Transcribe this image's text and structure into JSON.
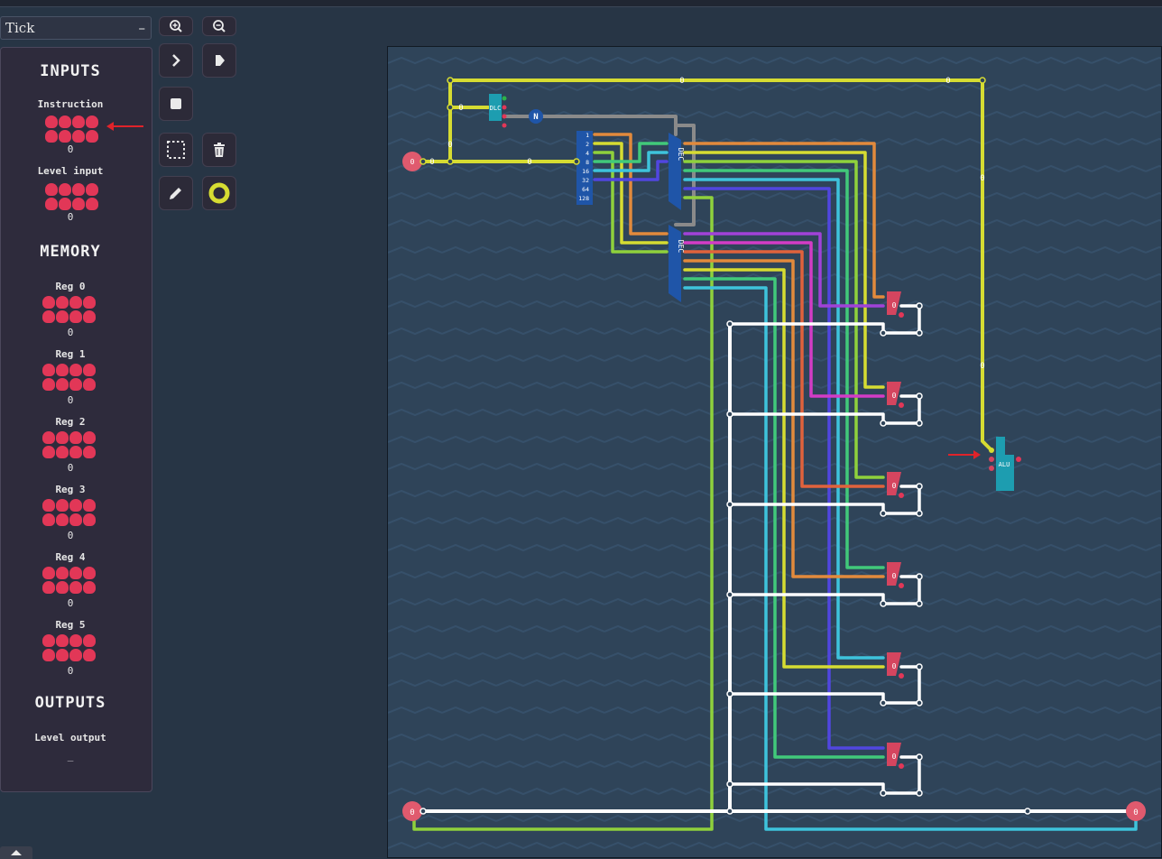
{
  "tick_dropdown": {
    "selected": "Tick",
    "collapse_symbol": "–"
  },
  "panel": {
    "inputs_title": "INPUTS",
    "instruction": {
      "label": "Instruction",
      "value": "0"
    },
    "level_input": {
      "label": "Level input",
      "value": "0"
    },
    "memory_title": "MEMORY",
    "registers": [
      {
        "label": "Reg 0",
        "value": "0"
      },
      {
        "label": "Reg 1",
        "value": "0"
      },
      {
        "label": "Reg 2",
        "value": "0"
      },
      {
        "label": "Reg 3",
        "value": "0"
      },
      {
        "label": "Reg 4",
        "value": "0"
      },
      {
        "label": "Reg 5",
        "value": "0"
      }
    ],
    "outputs_title": "OUTPUTS",
    "level_output": {
      "label": "Level output",
      "value": "_"
    }
  },
  "toolbar": {
    "zoom_in": "zoom-in-icon",
    "zoom_out": "zoom-out-icon",
    "step": "chevron-right-icon",
    "run": "play-icon",
    "stop": "stop-icon",
    "select": "selection-icon",
    "delete": "trash-icon",
    "pencil": "pencil-icon",
    "wire_color": "#d6dc32"
  },
  "circuit": {
    "wire_value": "0",
    "components": {
      "input_pin": "0",
      "clock_label": "DLC",
      "not_label": "N",
      "decoder_label": "DEC",
      "alu_label": "ALU",
      "byte_splitter_bits": [
        "1",
        "2",
        "4",
        "8",
        "16",
        "32",
        "64",
        "128"
      ],
      "register_value": "0",
      "bus_left_value": "0",
      "bus_right_value": "0"
    },
    "colors": {
      "yellow": "#d6dc32",
      "lime": "#8fd13c",
      "orange": "#e28a3c",
      "green": "#41c97a",
      "cyan": "#3ec3dc",
      "blue": "#5146e0",
      "purple": "#a042d8",
      "magenta": "#d33cc6",
      "red": "#e0623c",
      "gray": "#8a8a8a",
      "white": "#ffffff",
      "register": "#d5455f",
      "teal": "#1d9db0"
    }
  }
}
